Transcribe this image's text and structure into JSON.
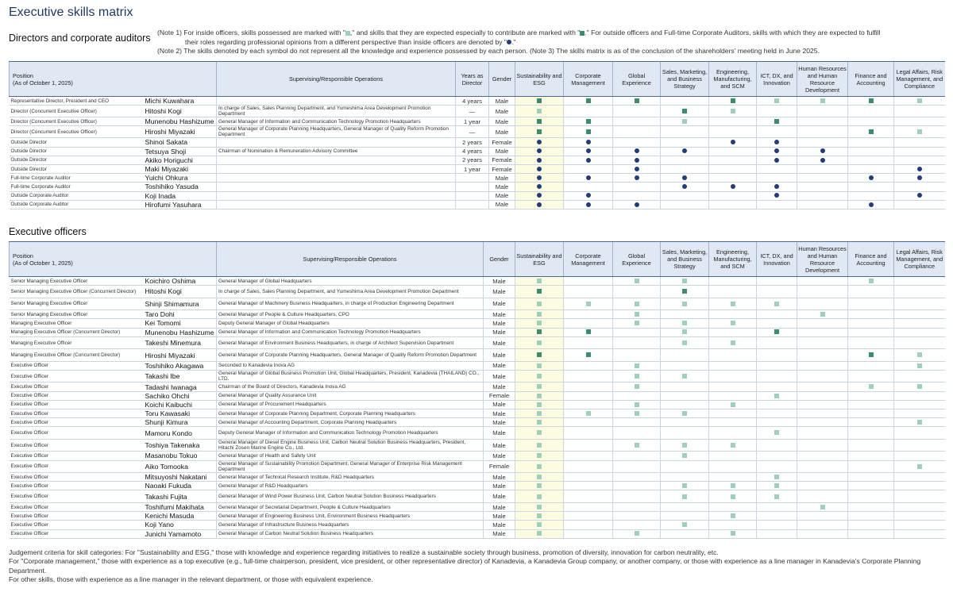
{
  "title": "Executive skills matrix",
  "section1_title": "Directors and corporate auditors",
  "section2_title": "Executive officers",
  "notes": {
    "n1a_pre": "(Note 1) For inside officers, skills possessed are marked with \"",
    "n1a_mid": ",\" and skills that they are expected especially to contribute are marked with \"",
    "n1a_post": ".\" For outside officers and Full-time Corporate Auditors, skills with which they are expected to fulfill",
    "n1b_pre": "their roles regarding professional opinions from a different perspective than inside officers are denoted by \"",
    "n1b_post": ".\"",
    "n2": "(Note 2) The skills denoted by each symbol do not represent all the knowledge and experience possessed by each person.     (Note 3) The skills matrix is as of the conclusion of the shareholders' meeting held in June 2025."
  },
  "headers": {
    "position": "Position",
    "as_of": "(As of October 1, 2025)",
    "operations": "Supervising/Responsible Operations",
    "years": "Years as Director",
    "gender": "Gender",
    "skills": [
      "Sustainability and ESG",
      "Corporate Management",
      "Global Experience",
      "Sales, Marketing, and Business Strategy",
      "Engineering, Manufacturing, and SCM",
      "ICT, DX, and Innovation",
      "Human Resources and Human Resource Development",
      "Finance and Accounting",
      "Legal Affairs, Risk Management, and Compliance"
    ]
  },
  "directors": [
    {
      "position": "Representative Director, President and CEO",
      "name": "Michi Kuwahara",
      "ops": "",
      "years": "4 years",
      "gender": "Male",
      "skills": "DDD0DLLDL"
    },
    {
      "position": "Director (Concurrent Executive Officer)",
      "name": "Hitoshi Kogi",
      "ops": "In charge of Sales, Sales Planning Department, and Yumeshima Area Development Promotion Department",
      "years": "—",
      "gender": "Male",
      "skills": "L00DL0000"
    },
    {
      "position": "Director (Concurrent Executive Officer)",
      "name": "Munenobu Hashizume",
      "ops": "General Manager of Information and Communication Technology Promotion Headquarters",
      "years": "1 year",
      "gender": "Male",
      "skills": "DD0L0D000"
    },
    {
      "position": "Director (Concurrent Executive Officer)",
      "name": "Hiroshi Miyazaki",
      "ops": "General Manager of Corporate Planning Headquarters, General Manager of Quality Reform Promotion Department",
      "years": "—",
      "gender": "Male",
      "skills": "DD00000DL"
    },
    {
      "position": "Outside Director",
      "name": "Shinoi Sakata",
      "ops": "",
      "years": "2 years",
      "gender": "Female",
      "skills": "BB00BB000"
    },
    {
      "position": "Outside Director",
      "name": "Tetsuya Shoji",
      "ops": "Chairman of Nomination & Remuneration Advisory Committee",
      "years": "4 years",
      "gender": "Male",
      "skills": "BBBB0BB00"
    },
    {
      "position": "Outside Director",
      "name": "Akiko Horiguchi",
      "ops": "",
      "years": "2 years",
      "gender": "Female",
      "skills": "BBB00BB00"
    },
    {
      "position": "Outside Director",
      "name": "Maki Miyazaki",
      "ops": "",
      "years": "1 year",
      "gender": "Female",
      "skills": "B0B00000B"
    },
    {
      "position": "Full-time Corporate Auditor",
      "name": "Yuichi Ohkura",
      "ops": "",
      "years": "",
      "gender": "Male",
      "skills": "BBBB000BB"
    },
    {
      "position": "Full-time Corporate Auditor",
      "name": "Toshihiko Yasuda",
      "ops": "",
      "years": "",
      "gender": "Male",
      "skills": "B00BBB000"
    },
    {
      "position": "Outside Corporate Auditor",
      "name": "Koji Inada",
      "ops": "",
      "years": "",
      "gender": "Male",
      "skills": "BB000B00B"
    },
    {
      "position": "Outside Corporate Auditor",
      "name": "Hirofumi Yasuhara",
      "ops": "",
      "years": "",
      "gender": "Male",
      "skills": "BBB0000B0"
    }
  ],
  "officers": [
    {
      "position": "Senior Managing Executive Officer",
      "name": "Koichiro Oshima",
      "ops": "General Manager of Global Headquarters",
      "gender": "Male",
      "skills": "L0LL000L0"
    },
    {
      "position": "Senior Managing Executive Officer (Concurrent Director)",
      "name": "Hitoshi Kogi",
      "ops": "In charge of Sales, Sales Planning Department, and Yumeshima Area Development Promotion Department",
      "gender": "Male",
      "skills": "D00D00000"
    },
    {
      "position": "Senior Managing Executive Officer",
      "name": "Shinji Shimamura",
      "ops": "General Manager of Machinery Business Headquarters, in charge of Production Engineering Department",
      "gender": "Male",
      "skills": "LLLLLL000"
    },
    {
      "position": "Senior Managing Executive Officer",
      "name": "Taro Dohi",
      "ops": "General Manager of People & Culture Headquarters, CPO",
      "gender": "Male",
      "skills": "L0L000L00"
    },
    {
      "position": "Managing Executive Officer",
      "name": "Kei Tomomi",
      "ops": "Deputy General Manager of Global Headquarters",
      "gender": "Male",
      "skills": "L0LLL0000"
    },
    {
      "position": "Managing Executive Officer (Concurrent Director)",
      "name": "Munenobu Hashizume",
      "ops": "General Manager of Information and Communication Technology Promotion Headquarters",
      "gender": "Male",
      "skills": "DD0L0D000"
    },
    {
      "position": "Managing Executive Officer",
      "name": "Takeshi Minemura",
      "ops": "General Manager of Environment Business Headquarters, in charge of Architect Supervision Department",
      "gender": "Male",
      "skills": "L00LL0000"
    },
    {
      "position": "Managing Executive Officer (Concurrent Director)",
      "name": "Hiroshi Miyazaki",
      "ops": "General Manager of Corporate Planning Headquarters, General Manager of Quality Reform Promotion Department",
      "gender": "Male",
      "skills": "DD00000DL"
    },
    {
      "position": "Executive Officer",
      "name": "Toshihiko Akagawa",
      "ops": "Seconded to Kanadevia Inova AG",
      "gender": "Male",
      "skills": "L0L00000L"
    },
    {
      "position": "Executive Officer",
      "name": "Takashi Ibe",
      "ops": "General Manager of Global Business Promotion Unit, Global Headquarters, President, Kanadevia (THAILAND) CO., LTD.",
      "gender": "Male",
      "skills": "L0LL00000"
    },
    {
      "position": "Executive Officer",
      "name": "Tadashi Iwanaga",
      "ops": "Chairman of the Board of Directors, Kanadevia Inova AG",
      "gender": "Male",
      "skills": "L0L0000LL"
    },
    {
      "position": "Executive Officer",
      "name": "Sachiko Ohchi",
      "ops": "General Manager of Quality Assurance Unit",
      "gender": "Female",
      "skills": "L0000L000"
    },
    {
      "position": "Executive Officer",
      "name": "Koichi Kaibuchi",
      "ops": "General Manager of Procurement Headquarters",
      "gender": "Male",
      "skills": "L0L0L0000"
    },
    {
      "position": "Executive Officer",
      "name": "Toru Kawasaki",
      "ops": "General Manager of Corporate Planning Department, Corporate Planning Headquarters",
      "gender": "Male",
      "skills": "LLLL00000"
    },
    {
      "position": "Executive Officer",
      "name": "Shunji Kimura",
      "ops": "General Manager of Accounting Department, Corporate Planning Headquarters",
      "gender": "Male",
      "skills": "L0000000L0"
    },
    {
      "position": "Executive Officer",
      "name": "Mamoru Kondo",
      "ops": "Deputy General Manager of Information and Communication Technology Promotion Headquarters",
      "gender": "Male",
      "skills": "L0000L000"
    },
    {
      "position": "Executive Officer",
      "name": "Toshiya Takenaka",
      "ops": "General Manager of Diesel Engine Business Unit, Carbon Neutral Solution Business Headquarters, President, Hitachi Zosen Marine Engine Co., Ltd.",
      "gender": "Male",
      "skills": "L0LLL0000"
    },
    {
      "position": "Executive Officer",
      "name": "Masanobu Tokuo",
      "ops": "General Manager of Health and Safety Unit",
      "gender": "Male",
      "skills": "L00L00000"
    },
    {
      "position": "Executive Officer",
      "name": "Aiko Tomooka",
      "ops": "General Manager of Sustainability Promotion Department, General Manager of Enterprise Risk Management Department",
      "gender": "Female",
      "skills": "L0000000L"
    },
    {
      "position": "Executive Officer",
      "name": "Mitsuyoshi Nakatani",
      "ops": "General Manager of Technical Research Institute, R&D Headquarters",
      "gender": "Male",
      "skills": "L0000L000"
    },
    {
      "position": "Executive Officer",
      "name": "Naoaki Fukuda",
      "ops": "General Manager of R&D Headquarters",
      "gender": "Male",
      "skills": "L00LLL000"
    },
    {
      "position": "Executive Officer",
      "name": "Takashi Fujita",
      "ops": "General Manager of Wind Power Business Unit, Carbon Neutral Solution Business Headquarters",
      "gender": "Male",
      "skills": "L00LLL000"
    },
    {
      "position": "Executive Officer",
      "name": "Toshifumi Makihata",
      "ops": "General Manager of Secretarial Department, People & Culture Headquarters",
      "gender": "Male",
      "skills": "L00000L00"
    },
    {
      "position": "Executive Officer",
      "name": "Kenichi Masuda",
      "ops": "General Manager of Engineering Business Unit, Environment Business Headquarters",
      "gender": "Male",
      "skills": "L000L0000"
    },
    {
      "position": "Executive Officer",
      "name": "Koji Yano",
      "ops": "General Manager of Infrastructure Business Headquarters",
      "gender": "Male",
      "skills": "L00L00000"
    },
    {
      "position": "Executive Officer",
      "name": "Junichi Yamamoto",
      "ops": "General Manager of Carbon Neutral Solution Business Headquarters",
      "gender": "Male",
      "skills": "L0L0L0000"
    }
  ],
  "footer": [
    "Judgement criteria for skill categories: For \"Sustainability and ESG,\" those with knowledge and experience regarding initiatives to realize a sustainable society through business, promotion of diversity, innovation for carbon neutrality, etc.",
    "For \"Corporate management,\" those with experience as a top executive (e.g., full-time chairperson, president, vice president, or other representative director) of Kanadevia, a Kanadevia Group company, or another company, or those with experience as a line manager in Kanadevia's Corporate Planning Department.",
    "For other skills, those with experience as a line manager in the relevant department, or those with equivalent experience."
  ],
  "colors": {
    "dark_marker": "#3c8c6e",
    "light_marker": "#9fd0bb",
    "dot_marker": "#233b7a",
    "header_bg": "#dfe8f3",
    "sustainability_bg": "#fdfbe0",
    "title": "#1f3864"
  }
}
